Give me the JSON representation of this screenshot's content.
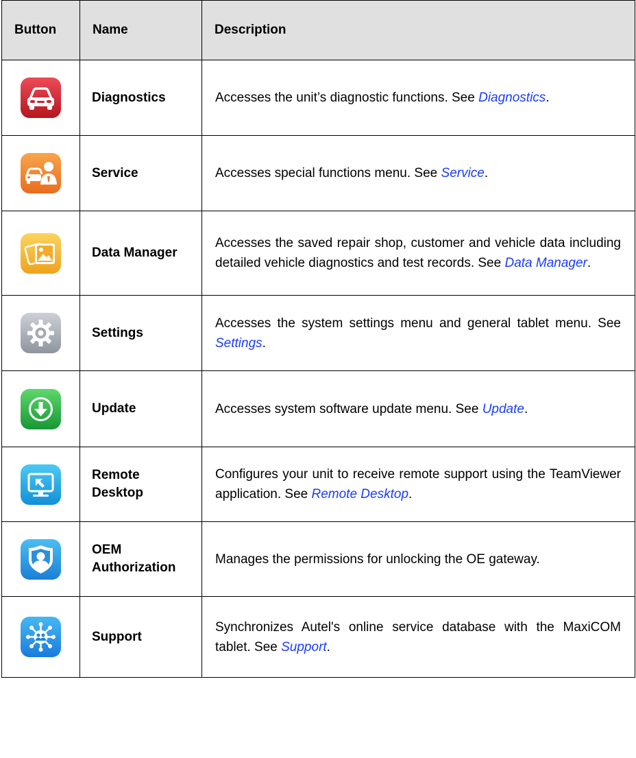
{
  "table": {
    "headers": [
      "Button",
      "Name",
      "Description"
    ],
    "rows": [
      {
        "icon": "diagnostics-car-icon",
        "color": "#d92b35",
        "name": "Diagnostics",
        "desc": "Accesses the unit’s diagnostic functions. See ",
        "link": "Diagnostics",
        "tail": "."
      },
      {
        "icon": "service-car-person-icon",
        "color": "#f2873a",
        "name": "Service",
        "desc": "Accesses special functions menu. See ",
        "link": "Service",
        "tail": "."
      },
      {
        "icon": "data-manager-photos-icon",
        "color": "#f5b93a",
        "name": "Data Manager",
        "desc": "Accesses the saved repair shop, customer and vehicle data including detailed vehicle diagnostics and test records. See ",
        "link": "Data Manager",
        "tail": "."
      },
      {
        "icon": "settings-gear-icon",
        "color": "#a9adb5",
        "name": "Settings",
        "desc": "Accesses the system settings menu and general tablet menu. See ",
        "link": "Settings",
        "tail": "."
      },
      {
        "icon": "update-download-icon",
        "color": "#2ab44a",
        "name": "Update",
        "desc": "Accesses system software update menu. See ",
        "link": "Update",
        "tail": "."
      },
      {
        "icon": "remote-desktop-monitor-icon",
        "color": "#26a8e6",
        "name_line1": "Remote",
        "name_line2": "Desktop",
        "desc": "Configures your unit to receive remote support using the TeamViewer application. See ",
        "link": "Remote Desktop",
        "tail": "."
      },
      {
        "icon": "oem-authorization-shield-icon",
        "color": "#2e9ae2",
        "name_line1": "OEM",
        "name_line2": "Authorization",
        "desc": "Manages the permissions for unlocking the OE gateway."
      },
      {
        "icon": "support-network-icon",
        "color": "#2d96e8",
        "name": "Support",
        "desc": "Synchronizes Autel's online service database with the MaxiCOM tablet. See ",
        "link": "Support",
        "tail": "."
      }
    ]
  }
}
